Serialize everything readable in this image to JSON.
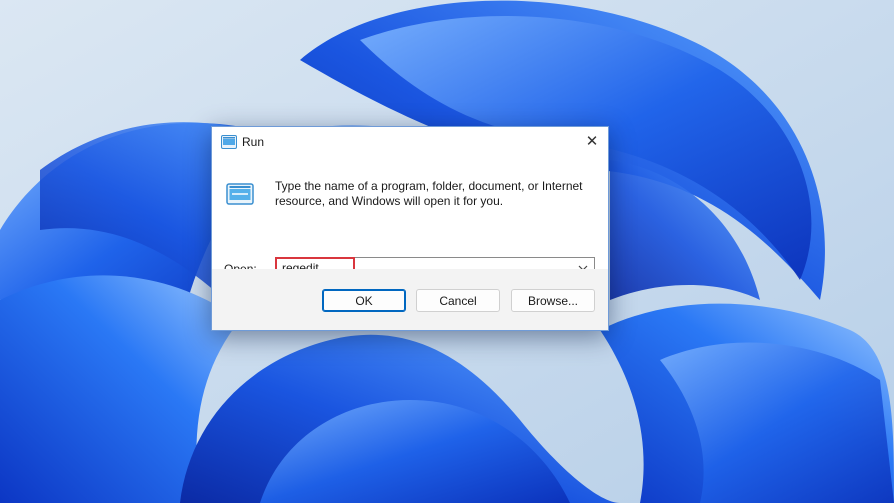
{
  "window": {
    "title": "Run",
    "close_glyph": "✕"
  },
  "dialog": {
    "description": "Type the name of a program, folder, document, or Internet resource, and Windows will open it for you.",
    "open_label_mnemonic": "O",
    "open_label_rest": "pen:",
    "open_value": "regedit"
  },
  "buttons": {
    "ok": "OK",
    "cancel": "Cancel",
    "browse": "Browse..."
  },
  "icons": {
    "title_icon": "run-app-icon",
    "dialog_icon": "run-app-icon",
    "dropdown": "chevron-down-icon",
    "close": "close-icon"
  },
  "colors": {
    "accent": "#0067c0",
    "highlight": "#d9363e",
    "wallpaper_blue": "#1a5be6"
  }
}
